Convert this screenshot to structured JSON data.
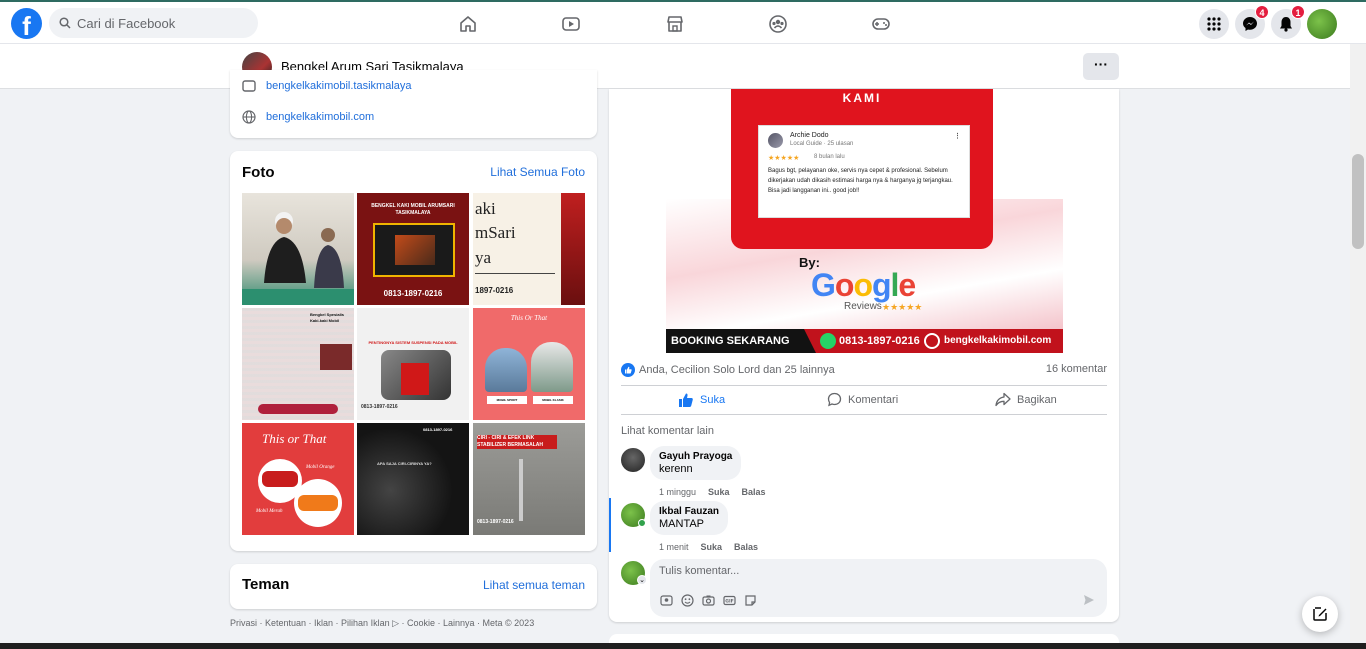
{
  "topnav": {
    "logo_letter": "f",
    "search_placeholder": "Cari di Facebook",
    "nav_icons": [
      "home-icon",
      "video-icon",
      "marketplace-icon",
      "groups-icon",
      "gaming-icon"
    ],
    "messenger_badge": "4",
    "notifications_badge": "1"
  },
  "pagebar": {
    "page_name": "Bengkel Arum Sari Tasikmalaya",
    "more_label": "···"
  },
  "intro": {
    "partial_link": "bengkelkakimobil.tasikmalaya",
    "website": "bengkelkakimobil.com"
  },
  "photos": {
    "title": "Foto",
    "see_all": "Lihat Semua Foto",
    "items": [
      {
        "alt": "Dua pria duduk di karpet"
      },
      {
        "alt": "Bengkel Kaki Mobil Arumsari Tasikmalaya",
        "text": "BENGKEL KAKI MOBIL ARUMSARI TASIKMALAYA",
        "phone": "0813-1897-0216"
      },
      {
        "text1": "aki",
        "text2": "mSari",
        "text3": "ya",
        "phone": "1897-0216"
      },
      {
        "text": "Bengkel Spesialis Kaki-kaki Mobil"
      },
      {
        "text": "PENTINGNYA SISTEM SUSPENSI PADA MOBIL",
        "phone": "0813-1897-0216"
      },
      {
        "text": "This Or That",
        "sub": "MOBIL SPORT",
        "sub2": "MOBIL KLASIK"
      },
      {
        "text": "This or That",
        "sub": "Mobil Orange",
        "sub2": "Mobil Merah"
      },
      {
        "text": "APA SAJA CIRI-CIRINYA YA?",
        "phone": "0813-1897-0216"
      },
      {
        "text": "CIRI - CIRI & EFEK LINK STABILIZER BERMASALAH",
        "phone": "0813-1897-0216"
      }
    ]
  },
  "friends": {
    "title": "Teman",
    "see_all": "Lihat semua teman"
  },
  "footer": {
    "links": "Privasi · Ketentuan · Iklan · Pilihan Iklan ▷ · Cookie · Lainnya · Meta © 2023"
  },
  "post": {
    "ad": {
      "header": "KAMI",
      "reviewer": "Archie Dodo",
      "reviewer_sub": "Local Guide · 25 ulasan",
      "stars": "★★★★★",
      "time": "8 bulan lalu",
      "review_text": "Bagus bgt, pelayanan oke, servis nya cepet & profesional. Sebelum dikerjakan udah dikasih estimasi harga nya & harganya jg terjangkau. Bisa jadi langganan ini.. good job!!",
      "by": "By:",
      "google": "Google",
      "reviews": "Reviews",
      "reviews_stars": "★★★★★",
      "booking": "BOOKING SEKARANG",
      "phone": "0813-1897-0216",
      "website": "bengkelkakimobil.com"
    },
    "reactions_text": "Anda, Cecilion Solo Lord dan 25 lainnya",
    "comments_count": "16 komentar",
    "actions": {
      "like": "Suka",
      "comment": "Komentari",
      "share": "Bagikan"
    },
    "more_comments": "Lihat komentar lain",
    "comments": [
      {
        "name": "Gayuh Prayoga",
        "text": "kerenn",
        "time": "1 minggu",
        "like": "Suka",
        "reply": "Balas"
      },
      {
        "name": "Ikbal Fauzan",
        "text": "MANTAP",
        "time": "1 menit",
        "like": "Suka",
        "reply": "Balas"
      }
    ],
    "compose_placeholder": "Tulis komentar..."
  },
  "colors": {
    "brand": "#1877f2",
    "link": "#216fdb",
    "ad_red": "#e0141e"
  }
}
